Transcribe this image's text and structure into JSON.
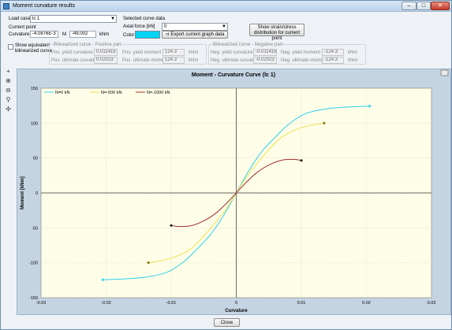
{
  "window": {
    "title": "Moment curvature results"
  },
  "controls": {
    "load_case_label": "Load case",
    "load_case_value": "lc 1",
    "current_point_label": "Current point",
    "curvature_label": "Curvature",
    "curvature_value": "-4.0876E-3",
    "m_label": "M",
    "m_value": "-49.002",
    "m_unit": "kNm",
    "selected_curve_label": "Selected curve data",
    "axial_force_label": "Axial force [kN]",
    "axial_force_value": "0",
    "color_label": "Color",
    "color_value": "#00d4f4",
    "export_button": "Export current graph data",
    "strain_button_line1": "Show strain/stress",
    "strain_button_line2": "distribution for current point",
    "show_bilinear_line1": "Show equivalent",
    "show_bilinear_line2": "bilinearized curve"
  },
  "bilinear_positive": {
    "header": "Bilinearized curve - Positive part",
    "yield_curv_label": "Pos. yield curvature",
    "yield_curv_value": "0.011418",
    "ult_curv_label": "Pos. ultimate curvature",
    "ult_curv_value": "0.02023",
    "yield_moment_label": "Pos. yield moment",
    "yield_moment_value": "124.3",
    "ult_moment_label": "Pos. ultimate moment",
    "ult_moment_value": "124.3",
    "unit": "kNm"
  },
  "bilinear_negative": {
    "header": "Bilinearized curve - Negative part",
    "yield_curv_label": "Neg. yield curvature",
    "yield_curv_value": "-0.011418",
    "ult_curv_label": "Neg. ultimate curvature",
    "ult_curv_value": "-0.02023",
    "yield_moment_label": "Neg. yield moment",
    "yield_moment_value": "-124.3",
    "ult_moment_label": "Neg. ultimate moment",
    "ult_moment_value": "-124.3",
    "unit": "kNm"
  },
  "toolbar": {
    "icons": [
      "plus-icon",
      "zoom-in-icon",
      "zoom-out-icon",
      "zoom-fit-icon",
      "crosshair-icon"
    ]
  },
  "close_button": "Close",
  "chart_data": {
    "type": "line",
    "title": "Moment - Curvature Curve (lc 1)",
    "xlabel": "Curvature",
    "ylabel": "Moment [kNm]",
    "xlim": [
      -0.03,
      0.03
    ],
    "ylim": [
      -150,
      150
    ],
    "xticks": [
      "-0.03",
      "-0.02",
      "-0.01",
      "0",
      "0.01",
      "0.02",
      "0.03"
    ],
    "yticks": [
      "150",
      "100",
      "50",
      "0",
      "-50",
      "-100",
      "-150"
    ],
    "grid": true,
    "legend_position": "top-left",
    "series": [
      {
        "name": "N=0 kN",
        "color": "#2fd0f0",
        "x": [
          -0.0205,
          -0.017,
          -0.0135,
          -0.0105,
          -0.008,
          -0.006,
          -0.004,
          -0.002,
          0,
          0.002,
          0.004,
          0.006,
          0.008,
          0.0105,
          0.0135,
          0.017,
          0.0205
        ],
        "y": [
          -124.3,
          -123,
          -120,
          -113,
          -98,
          -80,
          -60,
          -33,
          0,
          33,
          60,
          80,
          98,
          113,
          120,
          123,
          124.3
        ]
      },
      {
        "name": "N=-500 kN",
        "color": "#f0e050",
        "x": [
          -0.0135,
          -0.011,
          -0.009,
          -0.007,
          -0.005,
          -0.003,
          -0.0015,
          0,
          0.0015,
          0.003,
          0.005,
          0.007,
          0.009,
          0.011,
          0.0135
        ],
        "y": [
          -100,
          -96,
          -90,
          -80,
          -62,
          -40,
          -22,
          0,
          22,
          40,
          62,
          80,
          90,
          96,
          100
        ]
      },
      {
        "name": "N=-1000 kN",
        "color": "#a03030",
        "x": [
          -0.01,
          -0.009,
          -0.007,
          -0.005,
          -0.003,
          -0.001,
          0,
          0.001,
          0.003,
          0.005,
          0.007,
          0.009,
          0.01
        ],
        "y": [
          -46.5,
          -48,
          -47,
          -40,
          -28,
          -10,
          0,
          10,
          28,
          40,
          47,
          48,
          46.5
        ]
      }
    ]
  }
}
